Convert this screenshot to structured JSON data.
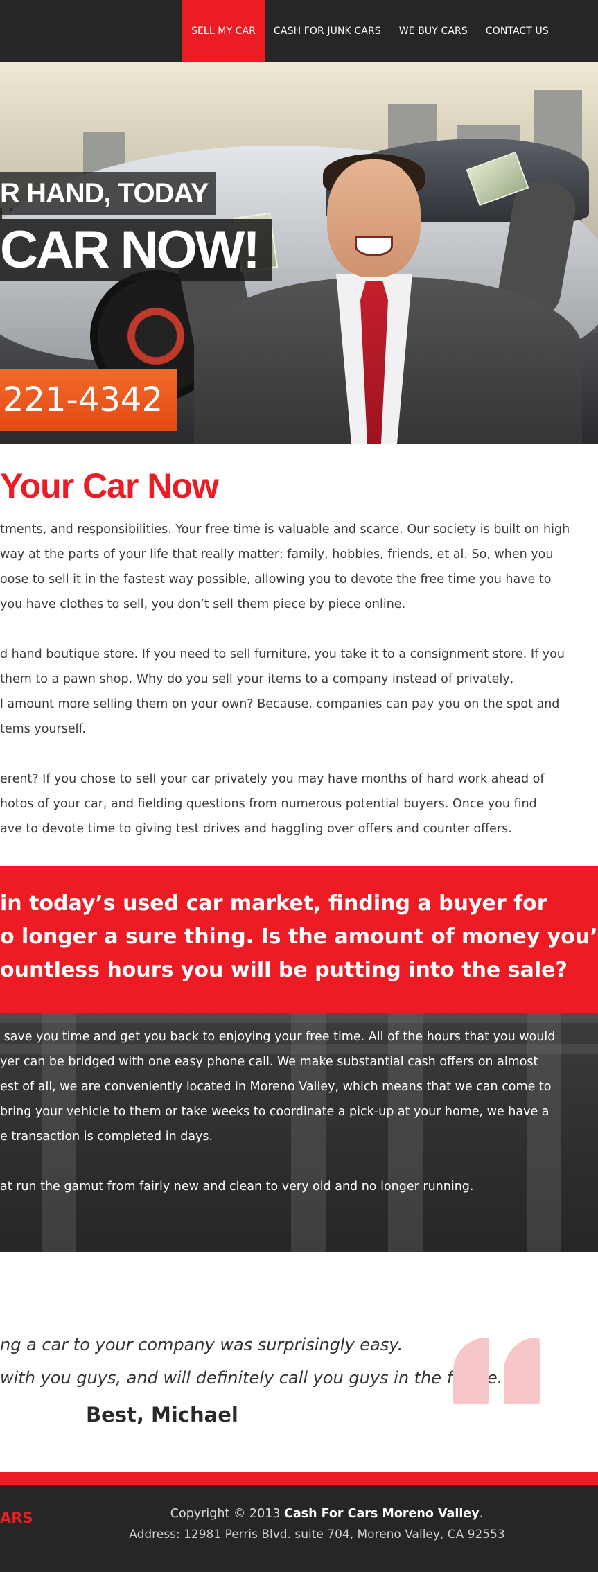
{
  "nav": {
    "items": [
      "SELL MY CAR",
      "CASH FOR JUNK CARS",
      "WE BUY CARS",
      "CONTACT US"
    ],
    "active_index": 0
  },
  "hero": {
    "tagline_small": "R HAND, TODAY",
    "tagline_large": "CAR NOW!",
    "phone": ") 221-4342",
    "colors": {
      "accent": "#ed1c24",
      "phone_bg": "#e8561a"
    }
  },
  "intro": {
    "title": "Your Car Now",
    "paragraphs": [
      [
        "tments, and responsibilities. Your free time is valuable and scarce. Our society is built on high",
        "way at the parts of your life that really matter: family, hobbies, friends, et al. So, when you",
        "oose to sell it in the fastest way possible, allowing you to devote the free time you have to",
        "you have clothes to sell, you don’t sell them piece by piece online."
      ],
      [
        "d hand boutique store. If you need to sell furniture, you take it to a consignment store. If you",
        "them to a pawn shop. Why do you sell your items to a company instead of privately,",
        "l amount more selling them on your own? Because, companies can pay you on the spot and",
        "tems yourself."
      ],
      [
        "erent? If you chose to sell your car privately you may have months of hard work ahead of",
        "hotos of your car, and fielding questions from numerous potential buyers. Once you find",
        "ave to devote time to giving test drives and haggling over offers and counter offers."
      ]
    ]
  },
  "callout": {
    "lines": [
      "in today’s used car market, finding a buyer for",
      "o longer a sure thing. Is the amount of money you’ll",
      "ountless hours you will be putting into the sale?"
    ]
  },
  "dark_section": {
    "lines": [
      " save you time and get you back to enjoying your free time. All of the hours that you would",
      "yer can be bridged with one easy phone call. We make substantial cash offers on almost",
      "est of all, we are conveniently located in Moreno Valley, which means that we can come to",
      "bring your vehicle to them or take weeks to coordinate a pick-up at your home, we have a",
      "e transaction is completed in days.",
      "",
      "at run the gamut from fairly new and clean to very old and no longer running."
    ]
  },
  "testimonial": {
    "lines": [
      "ng a car to your company was surprisingly easy.",
      "with you guys, and will definitely call you guys in the future.\""
    ],
    "signature": "Best, Michael"
  },
  "footer": {
    "logo_text": "ARS",
    "copyright_prefix": "Copyright © 2013 ",
    "company": "Cash For Cars Moreno Valley",
    "copyright_suffix": ".",
    "address": "Address: 12981 Perris Blvd. suite 704, Moreno Valley, CA 92553"
  }
}
